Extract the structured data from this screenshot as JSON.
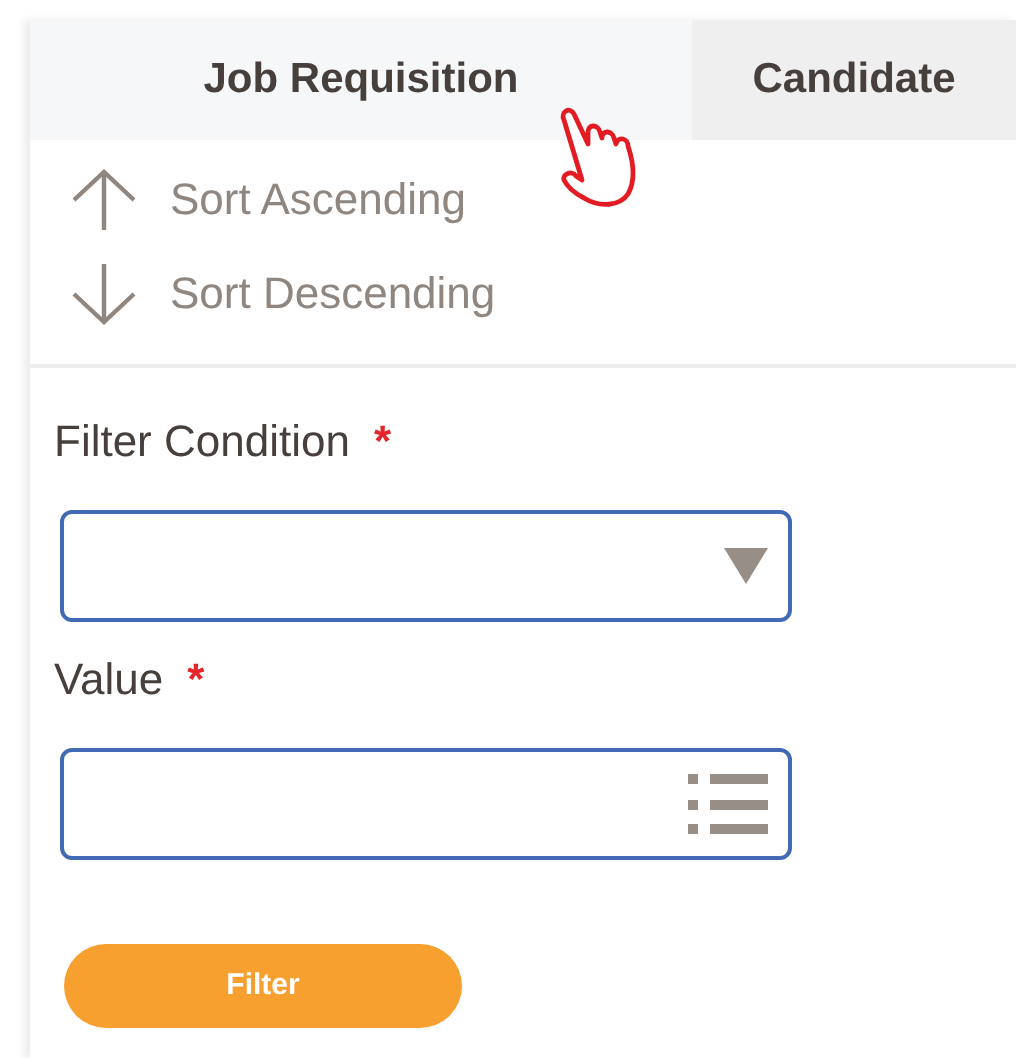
{
  "tabs": [
    {
      "label": "Job Requisition",
      "selected": true
    },
    {
      "label": "Candidate",
      "selected": false
    }
  ],
  "sort_options": [
    {
      "kind": "ascending",
      "label": "Sort Ascending"
    },
    {
      "kind": "descending",
      "label": "Sort Descending"
    }
  ],
  "fields": [
    {
      "kind": "select",
      "label": "Filter Condition",
      "required_mark": "*"
    },
    {
      "kind": "list",
      "label": "Value",
      "required_mark": "*"
    }
  ],
  "button": {
    "label": "Filter"
  }
}
